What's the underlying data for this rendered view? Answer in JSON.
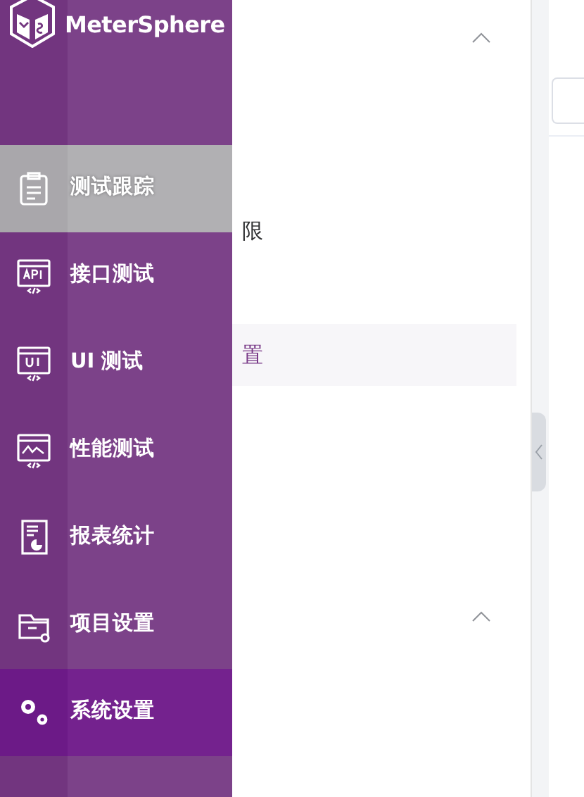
{
  "sidebar": {
    "brand": "MeterSphere",
    "items": [
      {
        "label": "测试跟踪",
        "kind": "clipboard",
        "hovered": true,
        "selected": false
      },
      {
        "label": "接口测试",
        "kind": "api",
        "hovered": false,
        "selected": false
      },
      {
        "label": "UI 测试",
        "kind": "ui",
        "hovered": false,
        "selected": false
      },
      {
        "label": "性能测试",
        "kind": "performance",
        "hovered": false,
        "selected": false
      },
      {
        "label": "报表统计",
        "kind": "report",
        "hovered": false,
        "selected": false
      },
      {
        "label": "项目设置",
        "kind": "folder",
        "hovered": false,
        "selected": false
      },
      {
        "label": "系统设置",
        "kind": "gears",
        "hovered": false,
        "selected": true
      }
    ]
  },
  "submenu": {
    "groups": [
      {
        "expanded": true,
        "items": [
          {
            "selected": false
          },
          {
            "selected": false
          },
          {
            "label": "限",
            "selected": false
          },
          {
            "selected": false
          },
          {
            "label": "置",
            "selected": true
          },
          {
            "selected": false
          },
          {
            "selected": false
          },
          {
            "selected": false
          }
        ]
      },
      {
        "expanded": true,
        "items": [
          {
            "selected": false
          },
          {
            "selected": false
          }
        ]
      }
    ]
  }
}
